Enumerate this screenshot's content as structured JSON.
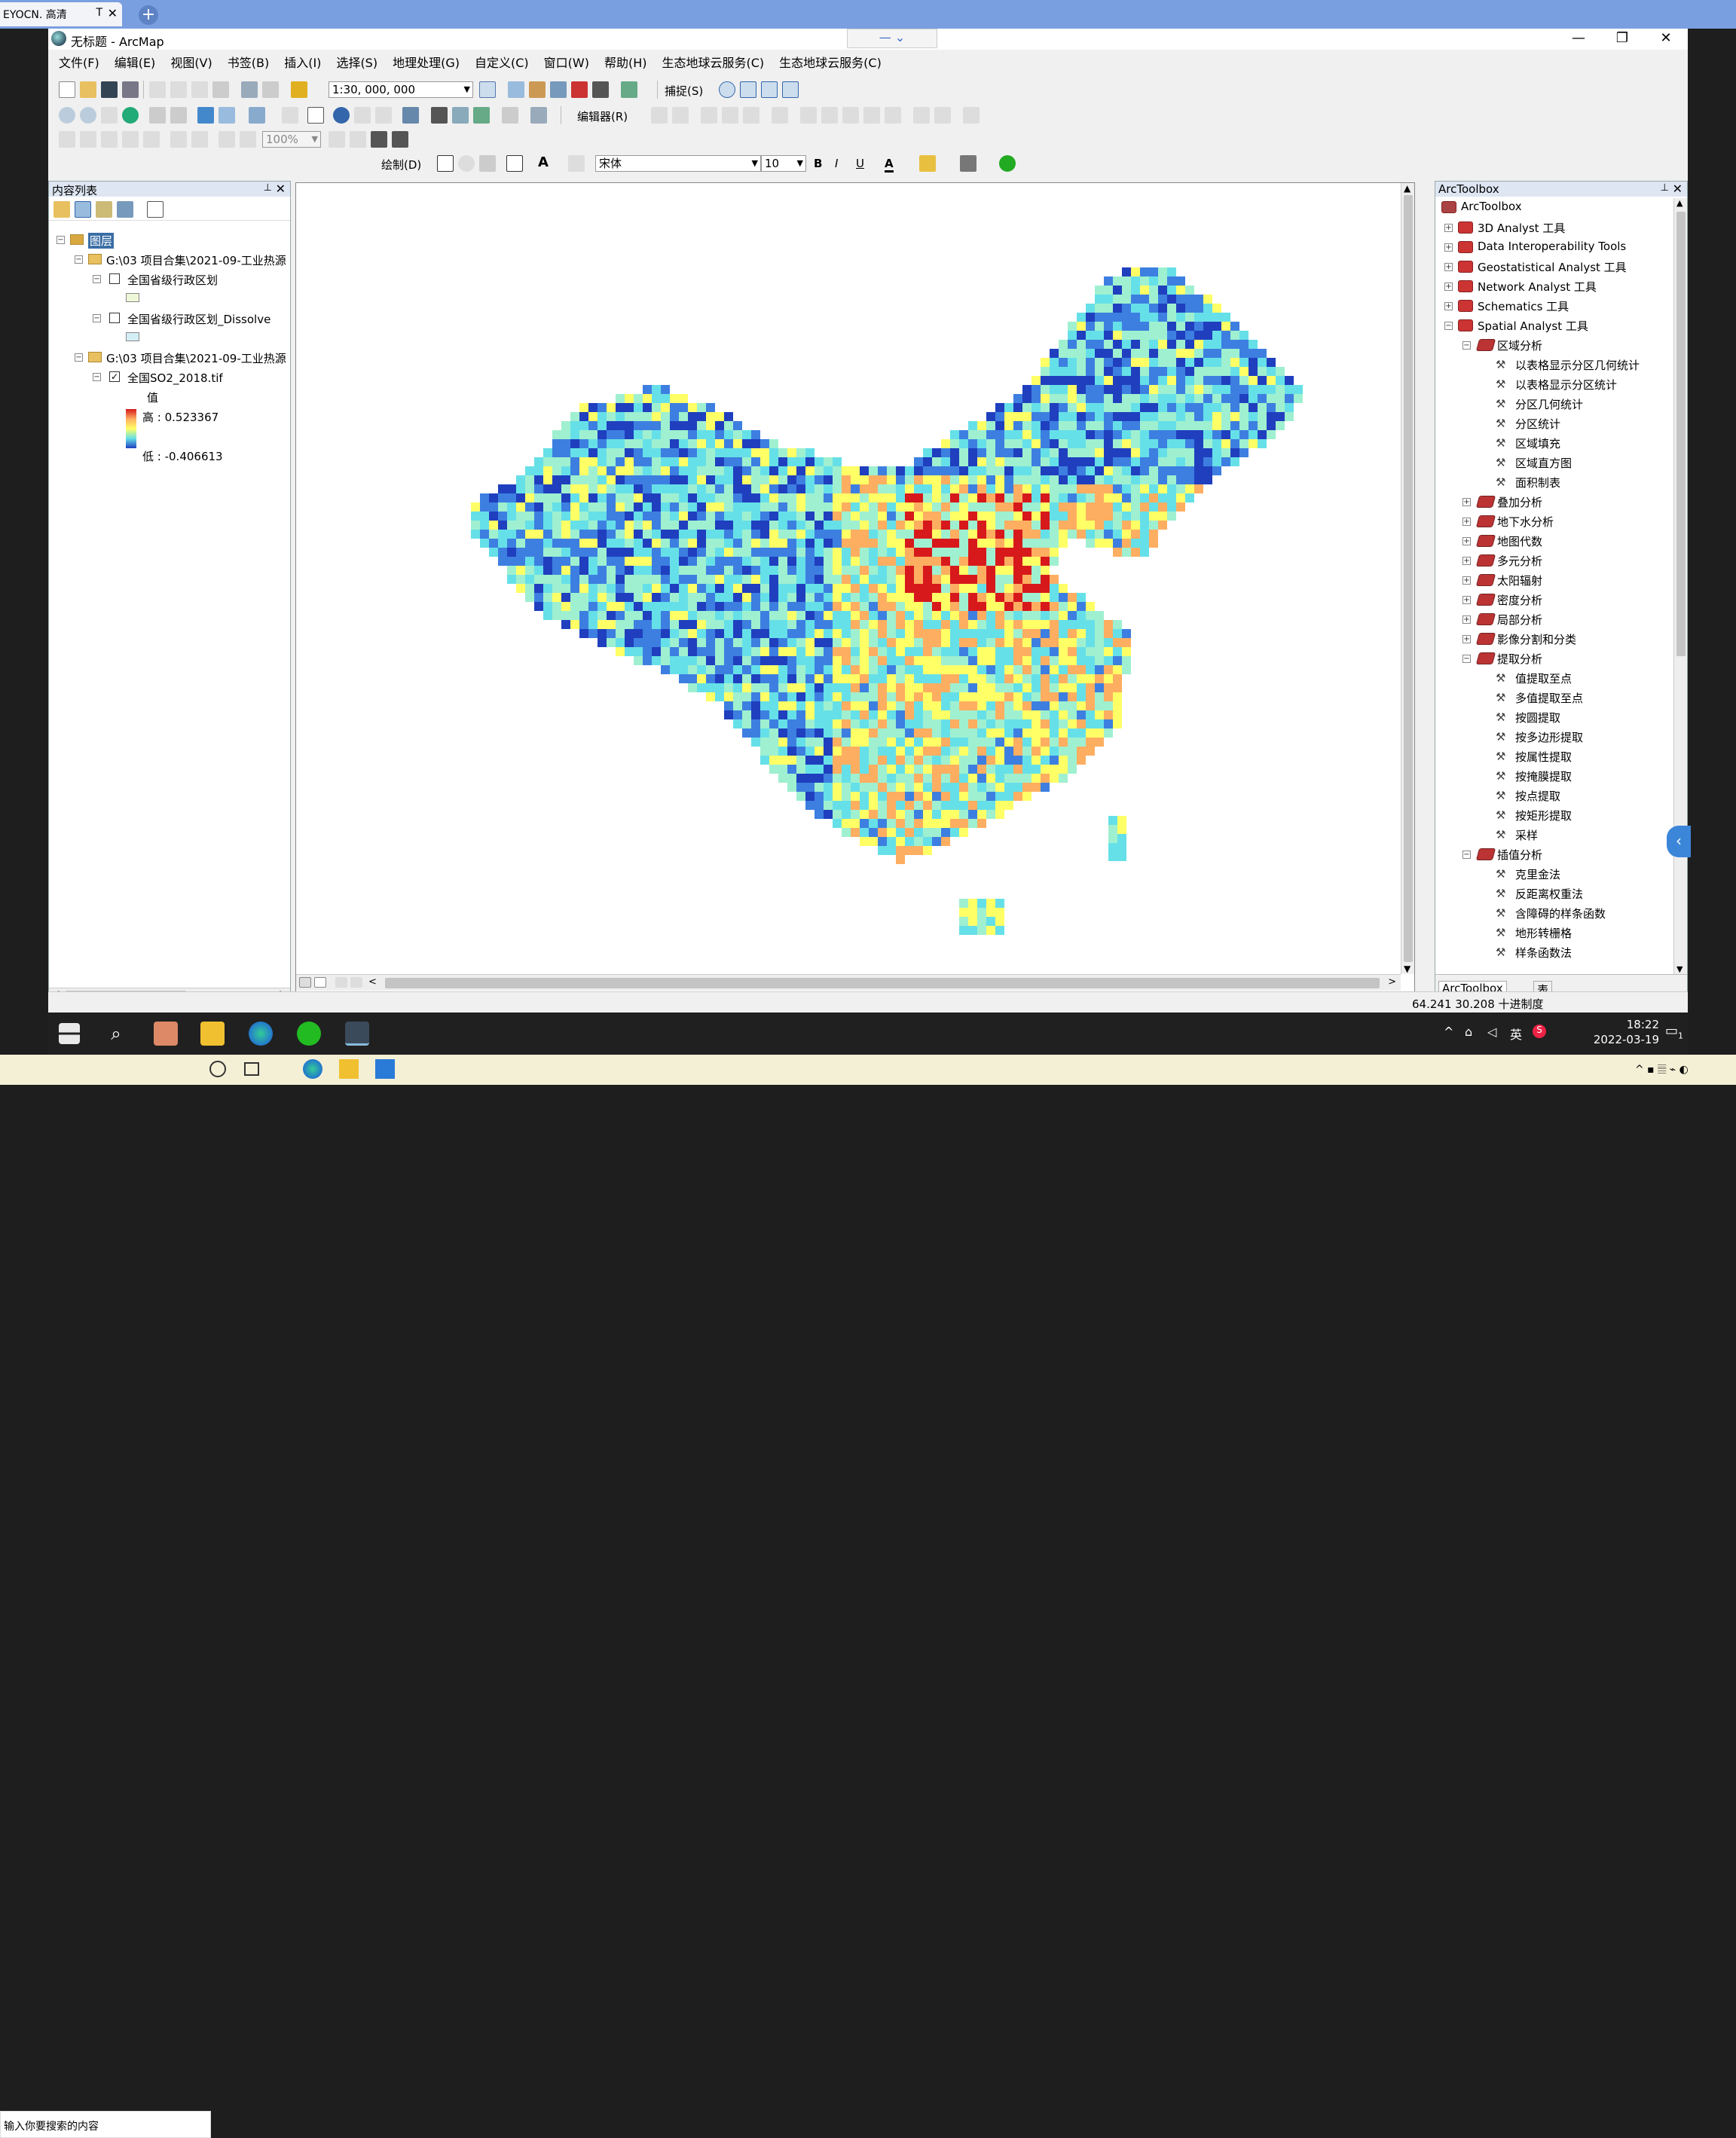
{
  "browser": {
    "tab_label": "EYOCN.  高清",
    "tab_extra": "T",
    "close_glyph": "✕",
    "new_tab_glyph": "+"
  },
  "window": {
    "title": "无标题 - ArcMap",
    "min_glyph": "—",
    "max_glyph": "❐",
    "close_glyph": "✕",
    "popup_text": "— ⌄"
  },
  "menu": [
    "文件(F)",
    "编辑(E)",
    "视图(V)",
    "书签(B)",
    "插入(I)",
    "选择(S)",
    "地理处理(G)",
    "自定义(C)",
    "窗口(W)",
    "帮助(H)",
    "生态地球云服务(C)",
    "生态地球云服务(C)"
  ],
  "toolbar": {
    "scale_value": "1:30, 000, 000",
    "snap_label": "捕捉(S)",
    "editor_label": "编辑器(R)",
    "zoom_value": "100%",
    "draw_label": "绘制(D)",
    "font_name": "宋体",
    "font_size": "10",
    "bold": "B",
    "italic": "I",
    "underline": "U",
    "font_color": "A"
  },
  "colors": {
    "accent": "#3a6ea5",
    "map_high": "#d7191c",
    "map_mid": "#ffff66",
    "map_cyan": "#66e0e8",
    "map_low": "#1f3fbf"
  },
  "toc": {
    "title": "内容列表",
    "pin_glyph": "📌",
    "close_glyph": "✕",
    "root_label": "图层",
    "group1_path": "G:\\03 项目合集\\2021-09-工业热源",
    "layer1_name": "全国省级行政区划",
    "layer1_checked": false,
    "layer2_name": "全国省级行政区划_Dissolve",
    "layer2_checked": false,
    "group2_path": "G:\\03 项目合集\\2021-09-工业热源",
    "layer3_name": "全国SO2_2018.tif",
    "layer3_checked": true,
    "legend_field": "值",
    "legend_high": "高 : 0.523367",
    "legend_low": "低 : -0.406613"
  },
  "arctoolbox": {
    "title": "ArcToolbox",
    "root": "ArcToolbox",
    "toolboxes": [
      {
        "label": "3D Analyst 工具",
        "expanded": false
      },
      {
        "label": "Data Interoperability Tools",
        "expanded": false
      },
      {
        "label": "Geostatistical Analyst 工具",
        "expanded": false
      },
      {
        "label": "Network Analyst 工具",
        "expanded": false
      },
      {
        "label": "Schematics 工具",
        "expanded": false
      },
      {
        "label": "Spatial Analyst 工具",
        "expanded": true
      }
    ],
    "spatial_items": [
      {
        "kind": "set",
        "label": "区域分析",
        "expanded": true
      },
      {
        "kind": "tool",
        "label": "以表格显示分区几何统计"
      },
      {
        "kind": "tool",
        "label": "以表格显示分区统计"
      },
      {
        "kind": "tool",
        "label": "分区几何统计"
      },
      {
        "kind": "tool",
        "label": "分区统计"
      },
      {
        "kind": "tool",
        "label": "区域填充"
      },
      {
        "kind": "tool",
        "label": "区域直方图"
      },
      {
        "kind": "tool",
        "label": "面积制表"
      },
      {
        "kind": "set",
        "label": "叠加分析",
        "expanded": false
      },
      {
        "kind": "set",
        "label": "地下水分析",
        "expanded": false
      },
      {
        "kind": "set",
        "label": "地图代数",
        "expanded": false
      },
      {
        "kind": "set",
        "label": "多元分析",
        "expanded": false
      },
      {
        "kind": "set",
        "label": "太阳辐射",
        "expanded": false
      },
      {
        "kind": "set",
        "label": "密度分析",
        "expanded": false
      },
      {
        "kind": "set",
        "label": "局部分析",
        "expanded": false
      },
      {
        "kind": "set",
        "label": "影像分割和分类",
        "expanded": false
      },
      {
        "kind": "set",
        "label": "提取分析",
        "expanded": true
      },
      {
        "kind": "tool",
        "label": "值提取至点"
      },
      {
        "kind": "tool",
        "label": "多值提取至点"
      },
      {
        "kind": "tool",
        "label": "按圆提取"
      },
      {
        "kind": "tool",
        "label": "按多边形提取"
      },
      {
        "kind": "tool",
        "label": "按属性提取"
      },
      {
        "kind": "tool",
        "label": "按掩膜提取"
      },
      {
        "kind": "tool",
        "label": "按点提取"
      },
      {
        "kind": "tool",
        "label": "按矩形提取"
      },
      {
        "kind": "tool",
        "label": "采样"
      },
      {
        "kind": "set",
        "label": "插值分析",
        "expanded": true
      },
      {
        "kind": "tool",
        "label": "克里金法"
      },
      {
        "kind": "tool",
        "label": "反距离权重法"
      },
      {
        "kind": "tool",
        "label": "含障碍的样条函数"
      },
      {
        "kind": "tool",
        "label": "地形转栅格"
      },
      {
        "kind": "tool",
        "label": "样条函数法"
      }
    ],
    "bottom_tab1": "ArcToolbox",
    "bottom_tab2": "表"
  },
  "status": {
    "coords": "64.241  30.208 十进制度"
  },
  "taskbar": {
    "time": "18:22",
    "date": "2022-03-19",
    "ime": "英",
    "notif_count": "1"
  },
  "taskbar2": {
    "search_placeholder": "输入你要搜索的内容"
  }
}
